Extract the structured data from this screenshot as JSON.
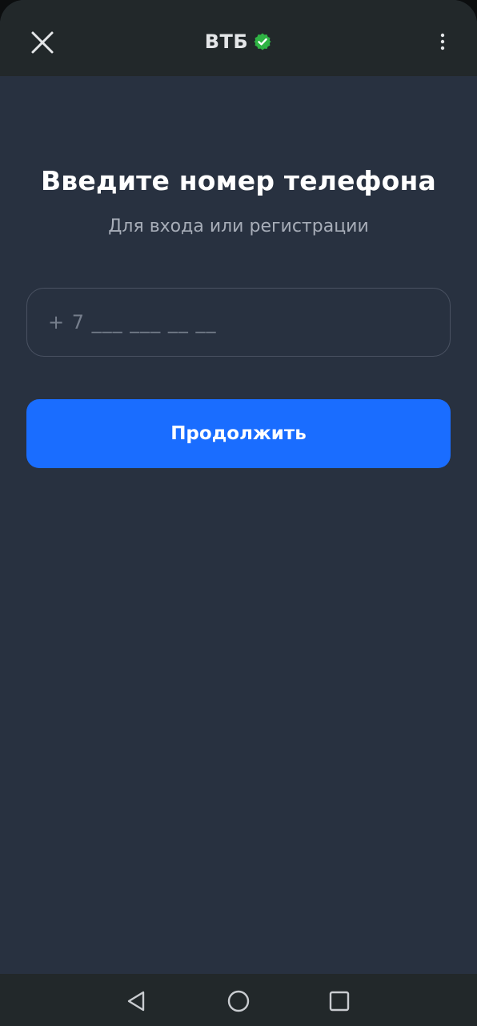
{
  "header": {
    "title": "ВТБ",
    "close_icon": "close-icon",
    "verified_icon": "verified-check-icon",
    "menu_icon": "more-vertical-icon",
    "verified_color": "#2fb344"
  },
  "main": {
    "heading": "Введите номер телефона",
    "subheading": "Для входа или регистрации",
    "phone_input": {
      "value": "",
      "placeholder": "+ 7 ___ ___ __ __"
    },
    "continue_label": "Продолжить"
  },
  "navbar": {
    "back_icon": "back-triangle-icon",
    "home_icon": "home-circle-icon",
    "recents_icon": "recents-square-icon"
  },
  "colors": {
    "background": "#283140",
    "bar": "#22282a",
    "accent": "#1a6dff"
  }
}
